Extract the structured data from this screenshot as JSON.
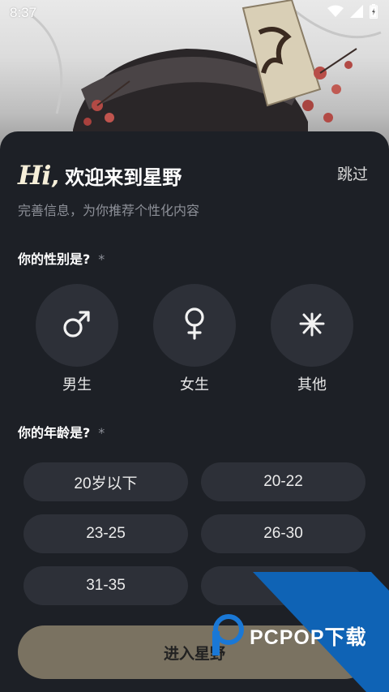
{
  "status_bar": {
    "time": "8:37",
    "icons": [
      "wifi-icon",
      "signal-icon",
      "battery-charging-icon"
    ]
  },
  "header": {
    "logo_text": "Hi",
    "logo_comma": ",",
    "welcome": "欢迎来到星野",
    "skip_label": "跳过",
    "subtitle": "完善信息，为你推荐个性化内容"
  },
  "gender": {
    "title": "你的性别是?",
    "required_mark": "*",
    "options": [
      {
        "label": "男生",
        "icon": "male-icon"
      },
      {
        "label": "女生",
        "icon": "female-icon"
      },
      {
        "label": "其他",
        "icon": "other-gender-icon"
      }
    ]
  },
  "age": {
    "title": "你的年龄是?",
    "required_mark": "*",
    "options": [
      "20岁以下",
      "20-22",
      "23-25",
      "26-30",
      "31-35",
      ""
    ]
  },
  "enter_label": "进入星野",
  "watermark": {
    "text": "PCPOP下载",
    "color": "#0f63b5"
  },
  "colors": {
    "sheet_bg": "#1d2026",
    "option_bg": "#2d3038",
    "enter_bg": "#7a7261"
  }
}
